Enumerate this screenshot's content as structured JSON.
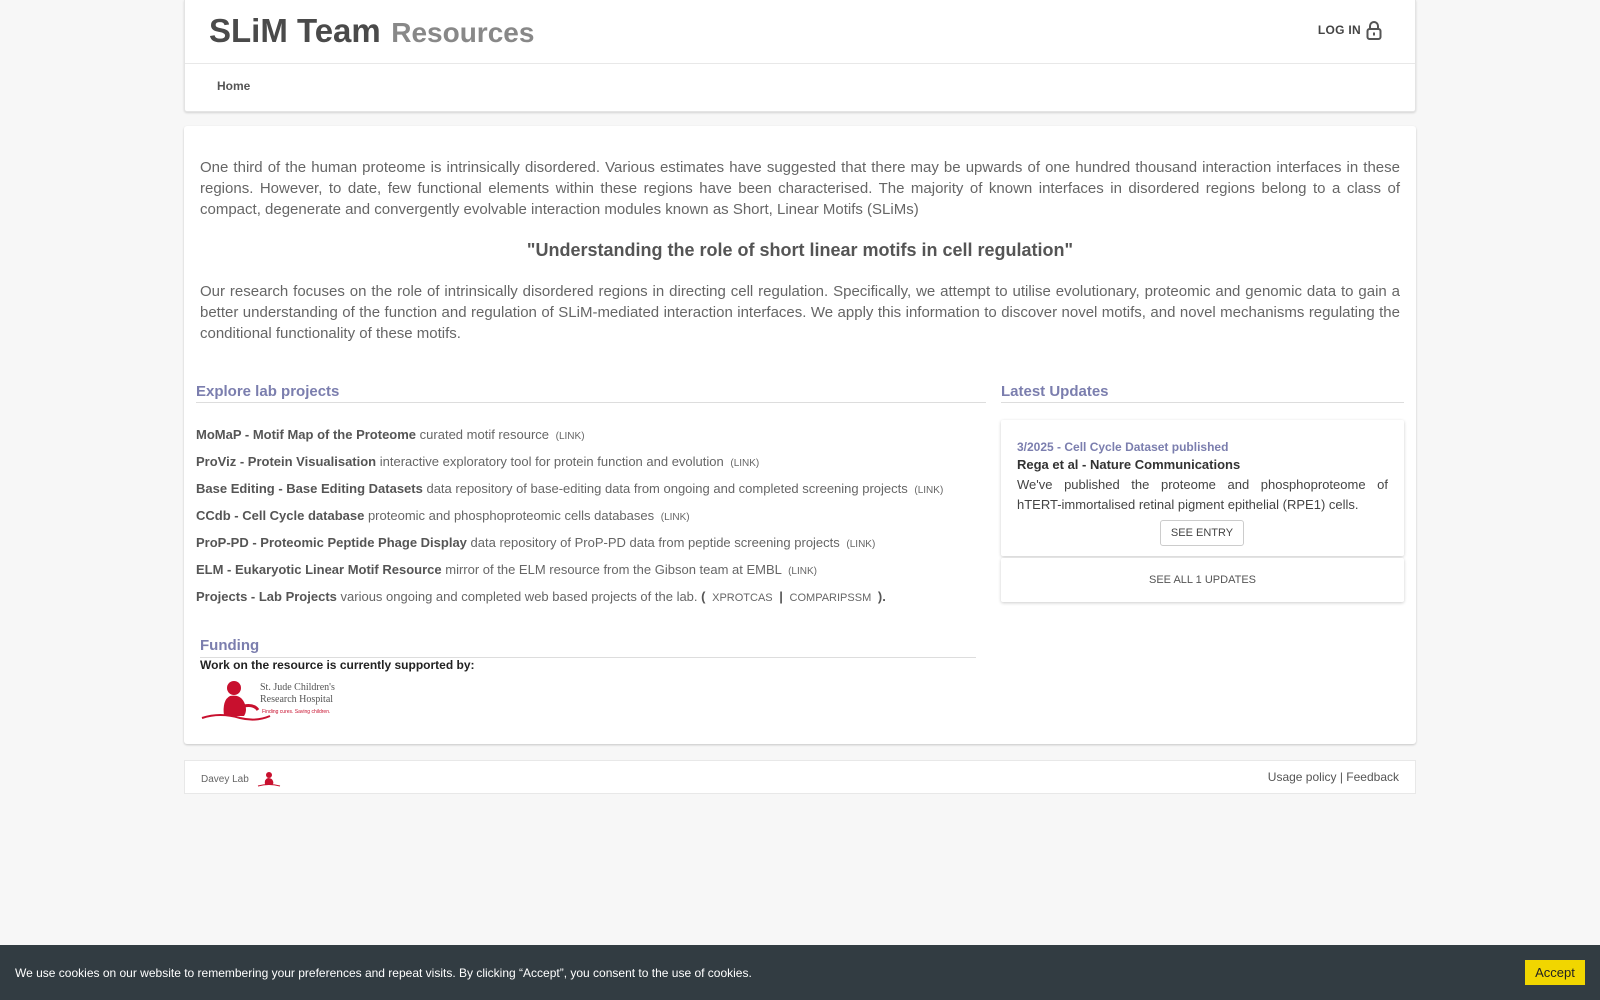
{
  "header": {
    "brand_main": "SLiM Team",
    "brand_sub": "Resources",
    "login_label": "LOG IN",
    "login_icon": "lock-icon",
    "nav": [
      {
        "label": "Home"
      }
    ]
  },
  "intro": {
    "paragraph1": "One third of the human proteome is intrinsically disordered. Various estimates have suggested that there may be upwards of one hundred thousand interaction interfaces in these regions. However, to date, few functional elements within these regions have been characterised. The majority of known interfaces in disordered regions belong to a class of compact, degenerate and convergently evolvable interaction modules known as Short, Linear Motifs (SLiMs)",
    "quote": "\"Understanding the role of short linear motifs in cell regulation\"",
    "paragraph2": "Our research focuses on the role of intrinsically disordered regions in directing cell regulation. Specifically, we attempt to utilise evolutionary, proteomic and genomic data to gain a better understanding of the function and regulation of SLiM-mediated interaction interfaces. We apply this information to discover novel motifs, and novel mechanisms regulating the conditional functionality of these motifs."
  },
  "projects": {
    "title": "Explore lab projects",
    "items": [
      {
        "name": "MoMaP - Motif Map of the Proteome",
        "desc": "curated motif resource",
        "link": "(LINK)"
      },
      {
        "name": "ProViz - Protein Visualisation",
        "desc": "interactive exploratory tool for protein function and evolution",
        "link": "(LINK)"
      },
      {
        "name": "Base Editing - Base Editing Datasets",
        "desc": "data repository of base-editing data from ongoing and completed screening projects",
        "link": "(LINK)"
      },
      {
        "name": "CCdb - Cell Cycle database",
        "desc": "proteomic and phosphoproteomic cells databases",
        "link": "(LINK)"
      },
      {
        "name": "ProP-PD - Proteomic Peptide Phage Display",
        "desc": "data repository of ProP-PD data from peptide screening projects",
        "link": "(LINK)"
      },
      {
        "name": "ELM - Eukaryotic Linear Motif Resource",
        "desc": "mirror of the ELM resource from the Gibson team at EMBL",
        "link": "(LINK)"
      }
    ],
    "last": {
      "name": "Projects - Lab Projects",
      "desc": "various ongoing and completed web based projects of the lab.",
      "open": "(",
      "sub1": "xProtCAS",
      "sep": "|",
      "sub2": "CompariPSSM",
      "close": ")."
    }
  },
  "updates": {
    "title": "Latest Updates",
    "entry": {
      "date": "3/2025 - Cell Cycle Dataset published",
      "title": "Rega et al - Nature Communications",
      "text": "We've published the proteome and phosphoproteome of hTERT-immortalised retinal pigment epithelial (RPE1) cells.",
      "button": "SEE ENTRY"
    },
    "see_all": "SEE ALL 1 UPDATES"
  },
  "funding": {
    "title": "Funding",
    "subtitle": "Work on the resource is currently supported by:",
    "sponsor": {
      "line1": "St. Jude Children's",
      "line2": "Research Hospital",
      "tagline": "Finding cures. Saving children.",
      "color": "#c8102e"
    }
  },
  "footer": {
    "brand": "Davey Lab",
    "usage": "Usage policy",
    "sep": "|",
    "feedback": "Feedback"
  },
  "cookie": {
    "text": "We use cookies on our website to remembering your preferences and repeat visits. By clicking “Accept”, you consent to the use of cookies.",
    "accept": "Accept"
  }
}
